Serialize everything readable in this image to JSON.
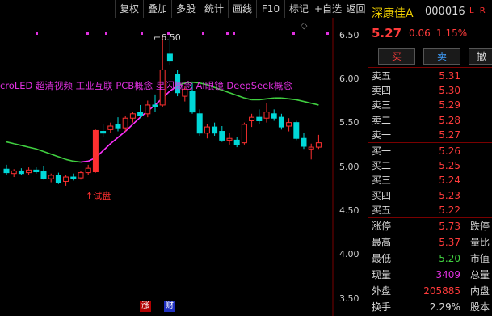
{
  "toolbar": {
    "buttons": [
      "复权",
      "叠加",
      "多股",
      "统计",
      "画线",
      "F10",
      "标记",
      "+自选",
      "返回"
    ]
  },
  "chart": {
    "y_ticks": [
      "6.50",
      "6.00",
      "5.50",
      "5.00",
      "4.50",
      "4.00",
      "3.50"
    ],
    "high_marker": "6.50",
    "concept_text": "croLED 超清视频 工业互联 PCB概念 星闪概念 AI眼镜 DeepSeek概念",
    "trial_label": "↑试盘",
    "bottom_badges": [
      "涨",
      "财"
    ],
    "colors": {
      "up": "#ff3030",
      "down": "#00d8d8",
      "ma_up": "#ff30ff",
      "ma_down": "#40d040",
      "concept": "#e030e0"
    }
  },
  "chart_data": {
    "type": "candlestick",
    "ylim": [
      3.45,
      6.6
    ],
    "y_ticks": [
      3.5,
      4.0,
      4.5,
      5.0,
      5.5,
      6.0,
      6.5
    ],
    "bars": [
      {
        "o": 4.97,
        "h": 5.02,
        "l": 4.9,
        "c": 4.93
      },
      {
        "o": 4.92,
        "h": 4.97,
        "l": 4.88,
        "c": 4.95
      },
      {
        "o": 4.95,
        "h": 4.98,
        "l": 4.9,
        "c": 4.92
      },
      {
        "o": 4.93,
        "h": 4.99,
        "l": 4.9,
        "c": 4.96
      },
      {
        "o": 4.96,
        "h": 4.99,
        "l": 4.92,
        "c": 4.94
      },
      {
        "o": 4.94,
        "h": 5.0,
        "l": 4.85,
        "c": 4.86
      },
      {
        "o": 4.86,
        "h": 4.92,
        "l": 4.82,
        "c": 4.9
      },
      {
        "o": 4.9,
        "h": 4.93,
        "l": 4.8,
        "c": 4.82
      },
      {
        "o": 4.83,
        "h": 4.9,
        "l": 4.78,
        "c": 4.88
      },
      {
        "o": 4.88,
        "h": 4.92,
        "l": 4.84,
        "c": 4.86
      },
      {
        "o": 4.87,
        "h": 4.95,
        "l": 4.85,
        "c": 4.93
      },
      {
        "o": 4.93,
        "h": 5.02,
        "l": 4.9,
        "c": 4.98
      },
      {
        "o": 4.94,
        "h": 5.42,
        "l": 4.93,
        "c": 5.41
      },
      {
        "o": 5.4,
        "h": 5.48,
        "l": 5.34,
        "c": 5.38
      },
      {
        "o": 5.42,
        "h": 5.5,
        "l": 5.38,
        "c": 5.46
      },
      {
        "o": 5.48,
        "h": 5.56,
        "l": 5.4,
        "c": 5.44
      },
      {
        "o": 5.44,
        "h": 5.58,
        "l": 5.4,
        "c": 5.55
      },
      {
        "o": 5.55,
        "h": 5.62,
        "l": 5.5,
        "c": 5.6
      },
      {
        "o": 5.62,
        "h": 5.7,
        "l": 5.55,
        "c": 5.58
      },
      {
        "o": 5.6,
        "h": 5.75,
        "l": 5.56,
        "c": 5.7
      },
      {
        "o": 5.7,
        "h": 5.82,
        "l": 5.62,
        "c": 5.68
      },
      {
        "o": 5.7,
        "h": 6.5,
        "l": 5.68,
        "c": 6.1
      },
      {
        "o": 6.28,
        "h": 6.48,
        "l": 6.15,
        "c": 6.2
      },
      {
        "o": 6.05,
        "h": 6.1,
        "l": 5.8,
        "c": 5.84
      },
      {
        "o": 5.8,
        "h": 5.92,
        "l": 5.74,
        "c": 5.88
      },
      {
        "o": 5.86,
        "h": 5.95,
        "l": 5.6,
        "c": 5.62
      },
      {
        "o": 5.6,
        "h": 5.65,
        "l": 5.35,
        "c": 5.38
      },
      {
        "o": 5.38,
        "h": 5.48,
        "l": 5.32,
        "c": 5.45
      },
      {
        "o": 5.45,
        "h": 5.5,
        "l": 5.35,
        "c": 5.38
      },
      {
        "o": 5.4,
        "h": 5.46,
        "l": 5.28,
        "c": 5.3
      },
      {
        "o": 5.3,
        "h": 5.38,
        "l": 5.25,
        "c": 5.32
      },
      {
        "o": 5.3,
        "h": 5.34,
        "l": 5.22,
        "c": 5.25
      },
      {
        "o": 5.27,
        "h": 5.5,
        "l": 5.25,
        "c": 5.48
      },
      {
        "o": 5.52,
        "h": 5.6,
        "l": 5.45,
        "c": 5.56
      },
      {
        "o": 5.56,
        "h": 5.65,
        "l": 5.48,
        "c": 5.52
      },
      {
        "o": 5.55,
        "h": 5.72,
        "l": 5.5,
        "c": 5.62
      },
      {
        "o": 5.6,
        "h": 5.65,
        "l": 5.52,
        "c": 5.55
      },
      {
        "o": 5.56,
        "h": 5.6,
        "l": 5.42,
        "c": 5.45
      },
      {
        "o": 5.46,
        "h": 5.55,
        "l": 5.4,
        "c": 5.5
      },
      {
        "o": 5.5,
        "h": 5.52,
        "l": 5.3,
        "c": 5.32
      },
      {
        "o": 5.32,
        "h": 5.38,
        "l": 5.2,
        "c": 5.23
      },
      {
        "o": 5.2,
        "h": 5.26,
        "l": 5.08,
        "c": 5.22
      },
      {
        "o": 5.22,
        "h": 5.36,
        "l": 5.2,
        "c": 5.27
      }
    ],
    "ma": [
      5.28,
      5.26,
      5.24,
      5.22,
      5.2,
      5.17,
      5.14,
      5.11,
      5.08,
      5.06,
      5.05,
      5.06,
      5.1,
      5.18,
      5.26,
      5.33,
      5.4,
      5.48,
      5.56,
      5.63,
      5.7,
      5.78,
      5.86,
      5.92,
      5.95,
      5.96,
      5.95,
      5.93,
      5.9,
      5.87,
      5.84,
      5.81,
      5.78,
      5.76,
      5.76,
      5.77,
      5.78,
      5.78,
      5.77,
      5.76,
      5.74,
      5.72,
      5.7
    ]
  },
  "quote": {
    "name": "深康佳A",
    "code": "000016",
    "lr": "L R",
    "price": "5.27",
    "change": "0.06",
    "change_pct": "1.15%",
    "buy_btn": "买",
    "sell_btn": "卖",
    "cancel_btn": "撤",
    "asks": [
      {
        "label": "卖五",
        "price": "5.31"
      },
      {
        "label": "卖四",
        "price": "5.30"
      },
      {
        "label": "卖三",
        "price": "5.29"
      },
      {
        "label": "卖二",
        "price": "5.28"
      },
      {
        "label": "卖一",
        "price": "5.27"
      }
    ],
    "bids": [
      {
        "label": "买一",
        "price": "5.26"
      },
      {
        "label": "买二",
        "price": "5.25"
      },
      {
        "label": "买三",
        "price": "5.24"
      },
      {
        "label": "买四",
        "price": "5.23"
      },
      {
        "label": "买五",
        "price": "5.22"
      }
    ],
    "stats": [
      {
        "label": "涨停",
        "value": "5.73",
        "color": "#ff3b3b",
        "label2": "跌停"
      },
      {
        "label": "最高",
        "value": "5.37",
        "color": "#ff3b3b",
        "label2": "量比"
      },
      {
        "label": "最低",
        "value": "5.20",
        "color": "#40d040",
        "label2": "市值"
      },
      {
        "label": "现量",
        "value": "3409",
        "color": "#e030e0",
        "label2": "总量"
      },
      {
        "label": "外盘",
        "value": "205885",
        "color": "#ff3b3b",
        "label2": "内盘"
      },
      {
        "label": "换手",
        "value": "2.29%",
        "color": "#d8d8d8",
        "label2": "股本"
      }
    ]
  }
}
